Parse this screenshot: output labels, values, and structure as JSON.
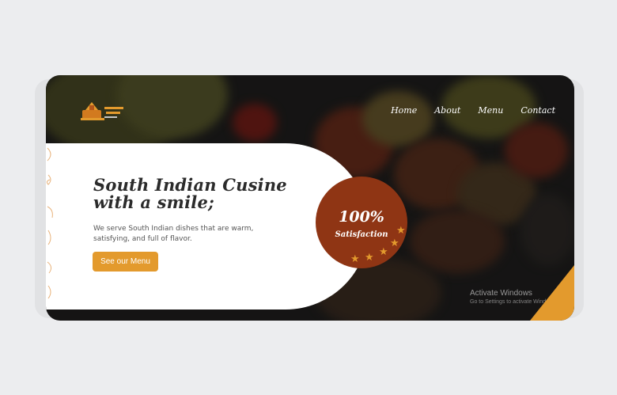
{
  "brand": {
    "logo_icon": "temple-logo-icon",
    "accent_color": "#e39a2d",
    "badge_color": "#8f3514"
  },
  "nav": {
    "items": [
      "Home",
      "About",
      "Menu",
      "Contact"
    ]
  },
  "hero": {
    "title_line1": "South Indian Cusine",
    "title_line2": "with a smile;",
    "description_line1": "We serve South Indian dishes that are warm,",
    "description_line2": "satisfying, and full of flavor.",
    "cta_label": "See our Menu"
  },
  "badge": {
    "percent": "100%",
    "label": "Satisfaction",
    "star_count": 5
  },
  "watermark": {
    "title": "Activate Windows",
    "subtitle": "Go to Settings to activate Windows."
  }
}
